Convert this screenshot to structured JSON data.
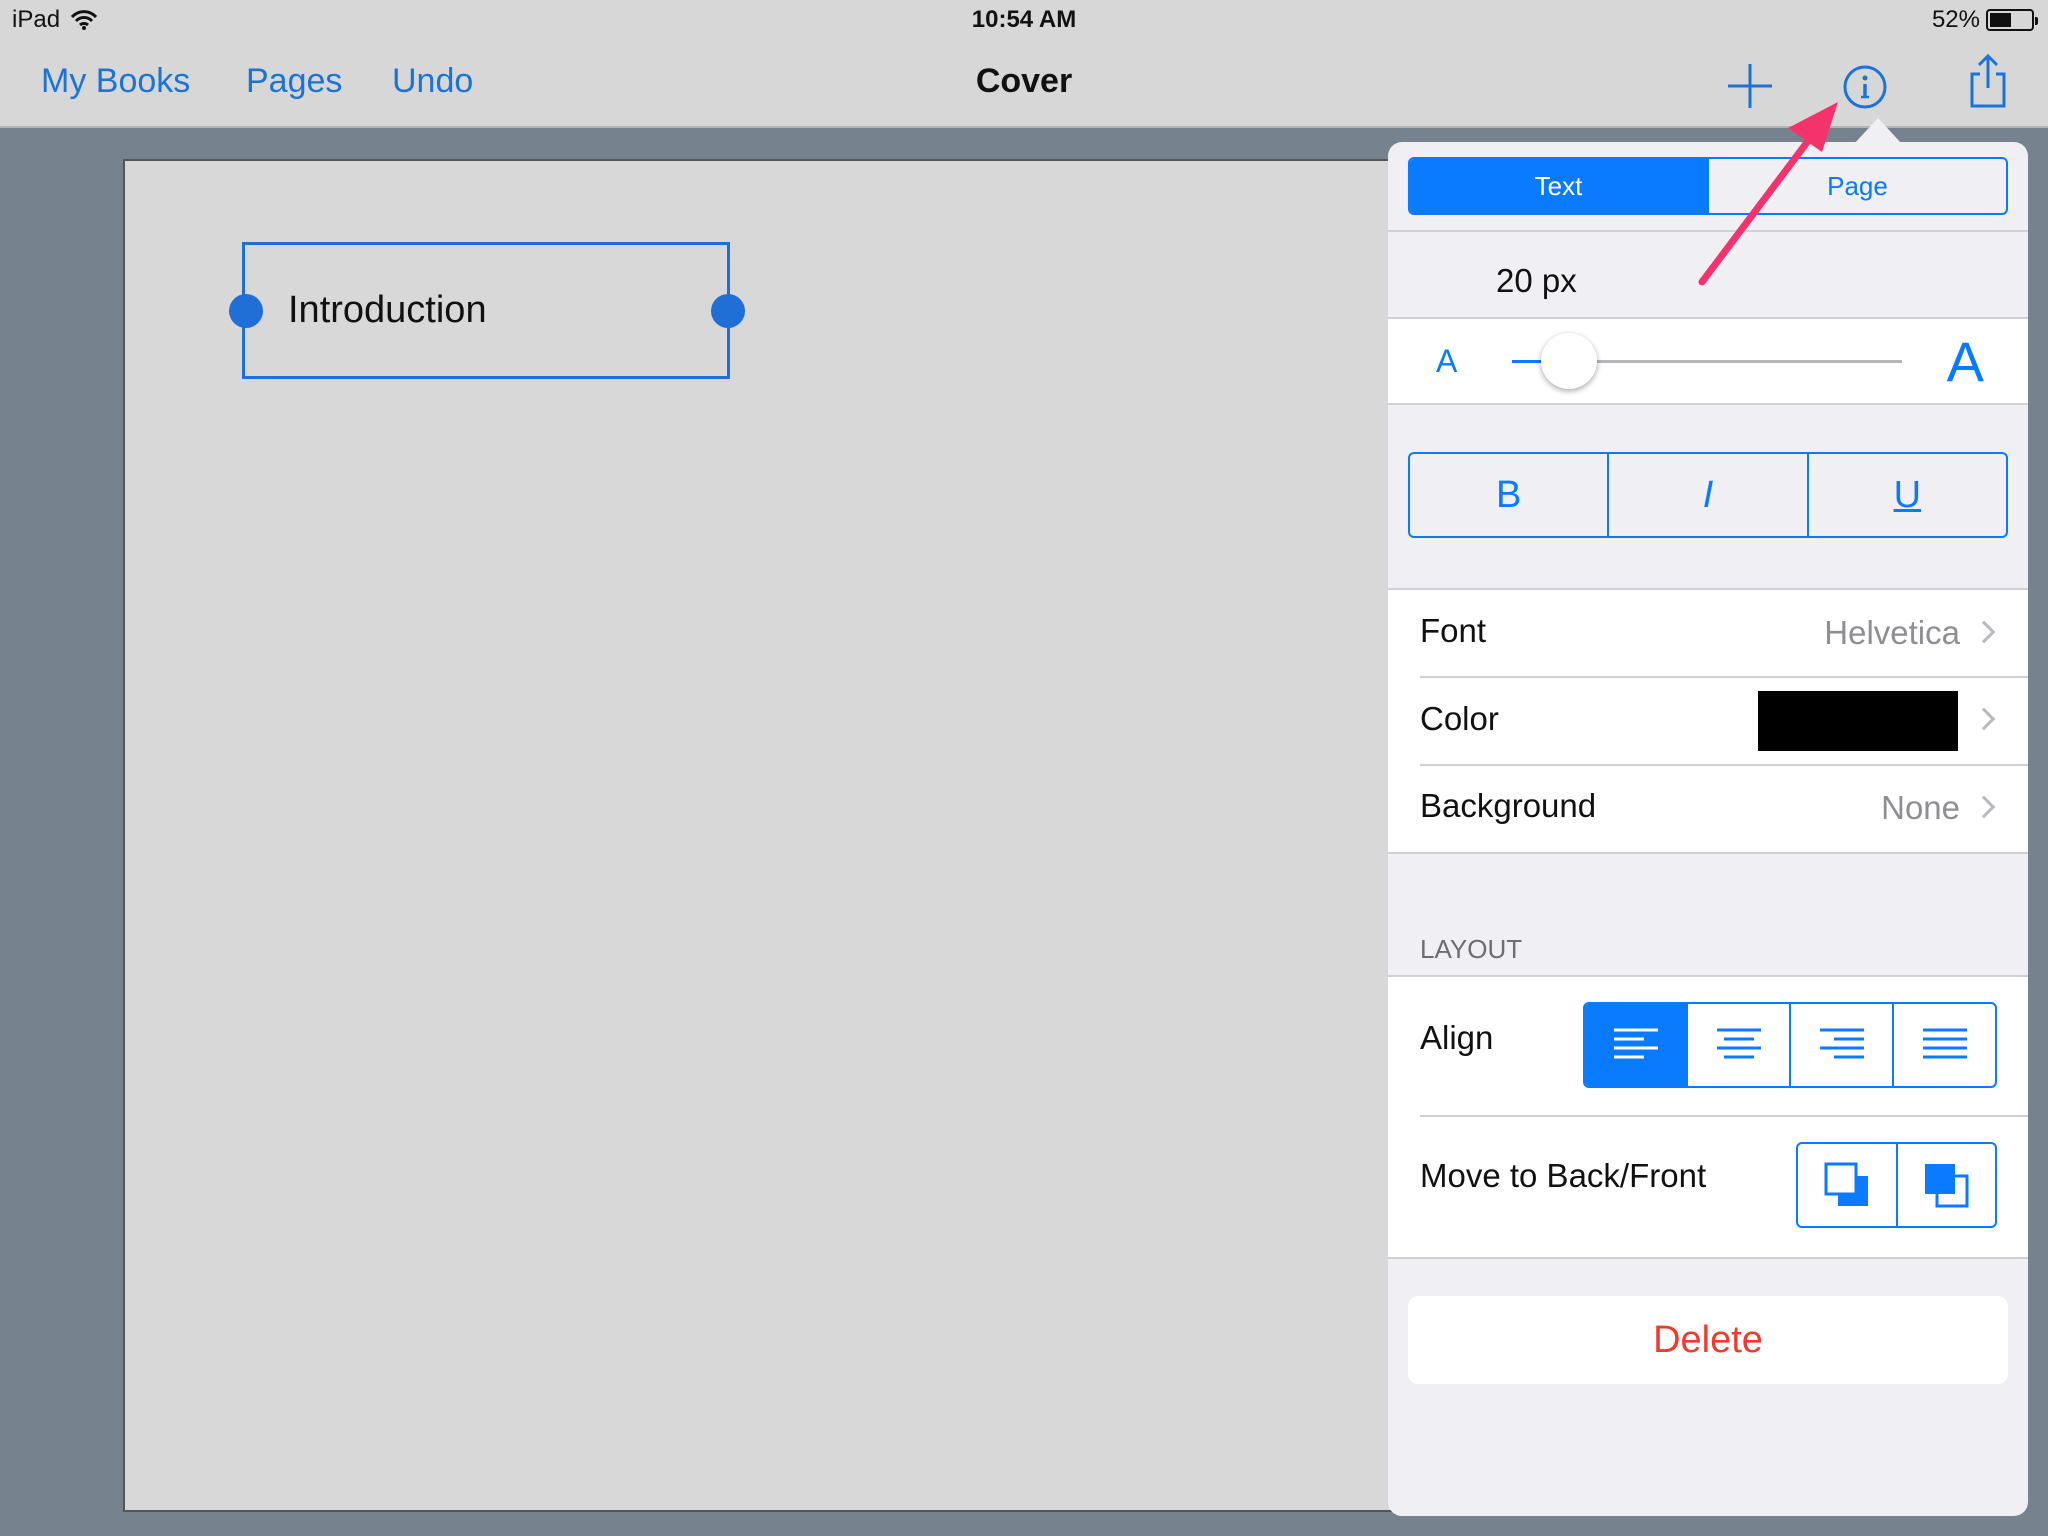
{
  "status": {
    "device": "iPad",
    "time": "10:54 AM",
    "battery": "52%",
    "battery_level": 0.52
  },
  "nav": {
    "my_books": "My Books",
    "pages": "Pages",
    "undo": "Undo",
    "title": "Cover"
  },
  "canvas": {
    "text_box": "Introduction"
  },
  "panel": {
    "tabs": [
      {
        "label": "Text",
        "active": true
      },
      {
        "label": "Page",
        "active": false
      }
    ],
    "font_size": "20 px",
    "slider": {
      "small_label": "A",
      "large_label": "A",
      "value": 0.12
    },
    "style_buttons": {
      "bold": "B",
      "italic": "I",
      "underline": "U"
    },
    "font": {
      "label": "Font",
      "value": "Helvetica"
    },
    "color": {
      "label": "Color",
      "swatch": "#000000"
    },
    "background": {
      "label": "Background",
      "value": "None"
    },
    "layout_header": "LAYOUT",
    "align": {
      "label": "Align",
      "selected": "left"
    },
    "move": {
      "label": "Move to Back/Front"
    },
    "delete": "Delete"
  },
  "colors": {
    "accent": "#0a7aff",
    "link": "#1a74d8",
    "delete": "#f03a2e",
    "annotation_arrow": "#f4336d"
  }
}
